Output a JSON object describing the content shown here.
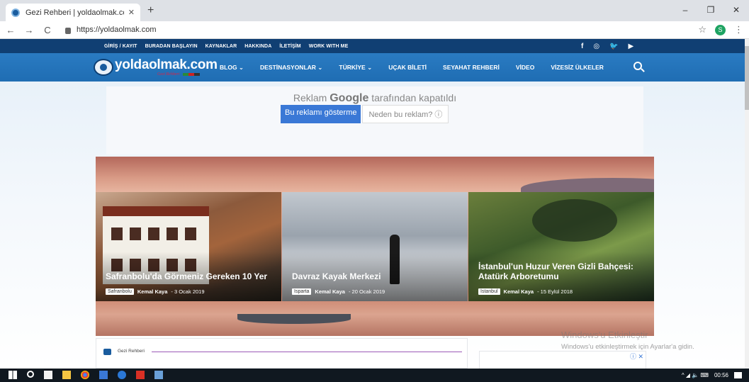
{
  "browser": {
    "tab_title": "Gezi Rehberi | yoldaolmak.com",
    "tab_close": "✕",
    "new_tab": "+",
    "url": "https://yoldaolmak.com",
    "profile_initial": "S",
    "window_controls": [
      "–",
      "❐",
      "✕"
    ]
  },
  "topstrip": {
    "links": [
      "GİRİŞ / KAYIT",
      "BURADAN BAŞLAYIN",
      "KAYNAKLAR",
      "HAKKINDA",
      "İLETİŞİM",
      "WORK WITH ME"
    ],
    "social_icons": [
      "facebook-icon",
      "instagram-icon",
      "twitter-icon",
      "youtube-icon"
    ],
    "social_glyphs": [
      "f",
      "◎",
      "🐦",
      "▶"
    ]
  },
  "header": {
    "logo_text": "yoldaolmak.com",
    "logo_sub": "Gezi Rehberi",
    "nav": [
      "BLOG ⌄",
      "DESTİNASYONLAR ⌄",
      "TÜRKİYE ⌄",
      "UÇAK BİLETİ",
      "SEYAHAT REHBERİ",
      "VİDEO",
      "VİZESİZ ÜLKELER"
    ]
  },
  "ad": {
    "caption_pre": "Reklam",
    "caption_brand": "Google",
    "caption_post": "tarafından kapatıldı",
    "show_button": "Bu reklamı gösterme",
    "why_button": "Neden bu reklam? ⓘ"
  },
  "cards": [
    {
      "title": "Safranbolu'da Görmeniz Gereken 10 Yer",
      "tag": "Safranbolu",
      "author": "Kemal Kaya",
      "date": "- 3 Ocak 2019"
    },
    {
      "title": "Davraz Kayak Merkezi",
      "tag": "Isparta",
      "author": "Kemal Kaya",
      "date": "- 20 Ocak 2019"
    },
    {
      "title": "İstanbul'un Huzur Veren Gizli Bahçesi: Atatürk Arboretumu",
      "tag": "İstanbul",
      "author": "Kemal Kaya",
      "date": "- 15 Eylül 2018"
    }
  ],
  "content": {
    "label": "Gezi Rehberi"
  },
  "side_ad": {
    "close": "ⓘ ✕"
  },
  "watermark": {
    "title": "Windows'u Etkinleştir",
    "sub": "Windows'u etkinleştirmek için Ayarlar'a gidin."
  },
  "taskbar": {
    "time": "00:56",
    "tray_glyphs": "^ ◢ 🔈 ⌨"
  },
  "colors": {
    "topstrip": "#103f73",
    "header": "#1f6fb6",
    "accent": "#3a78d6"
  }
}
